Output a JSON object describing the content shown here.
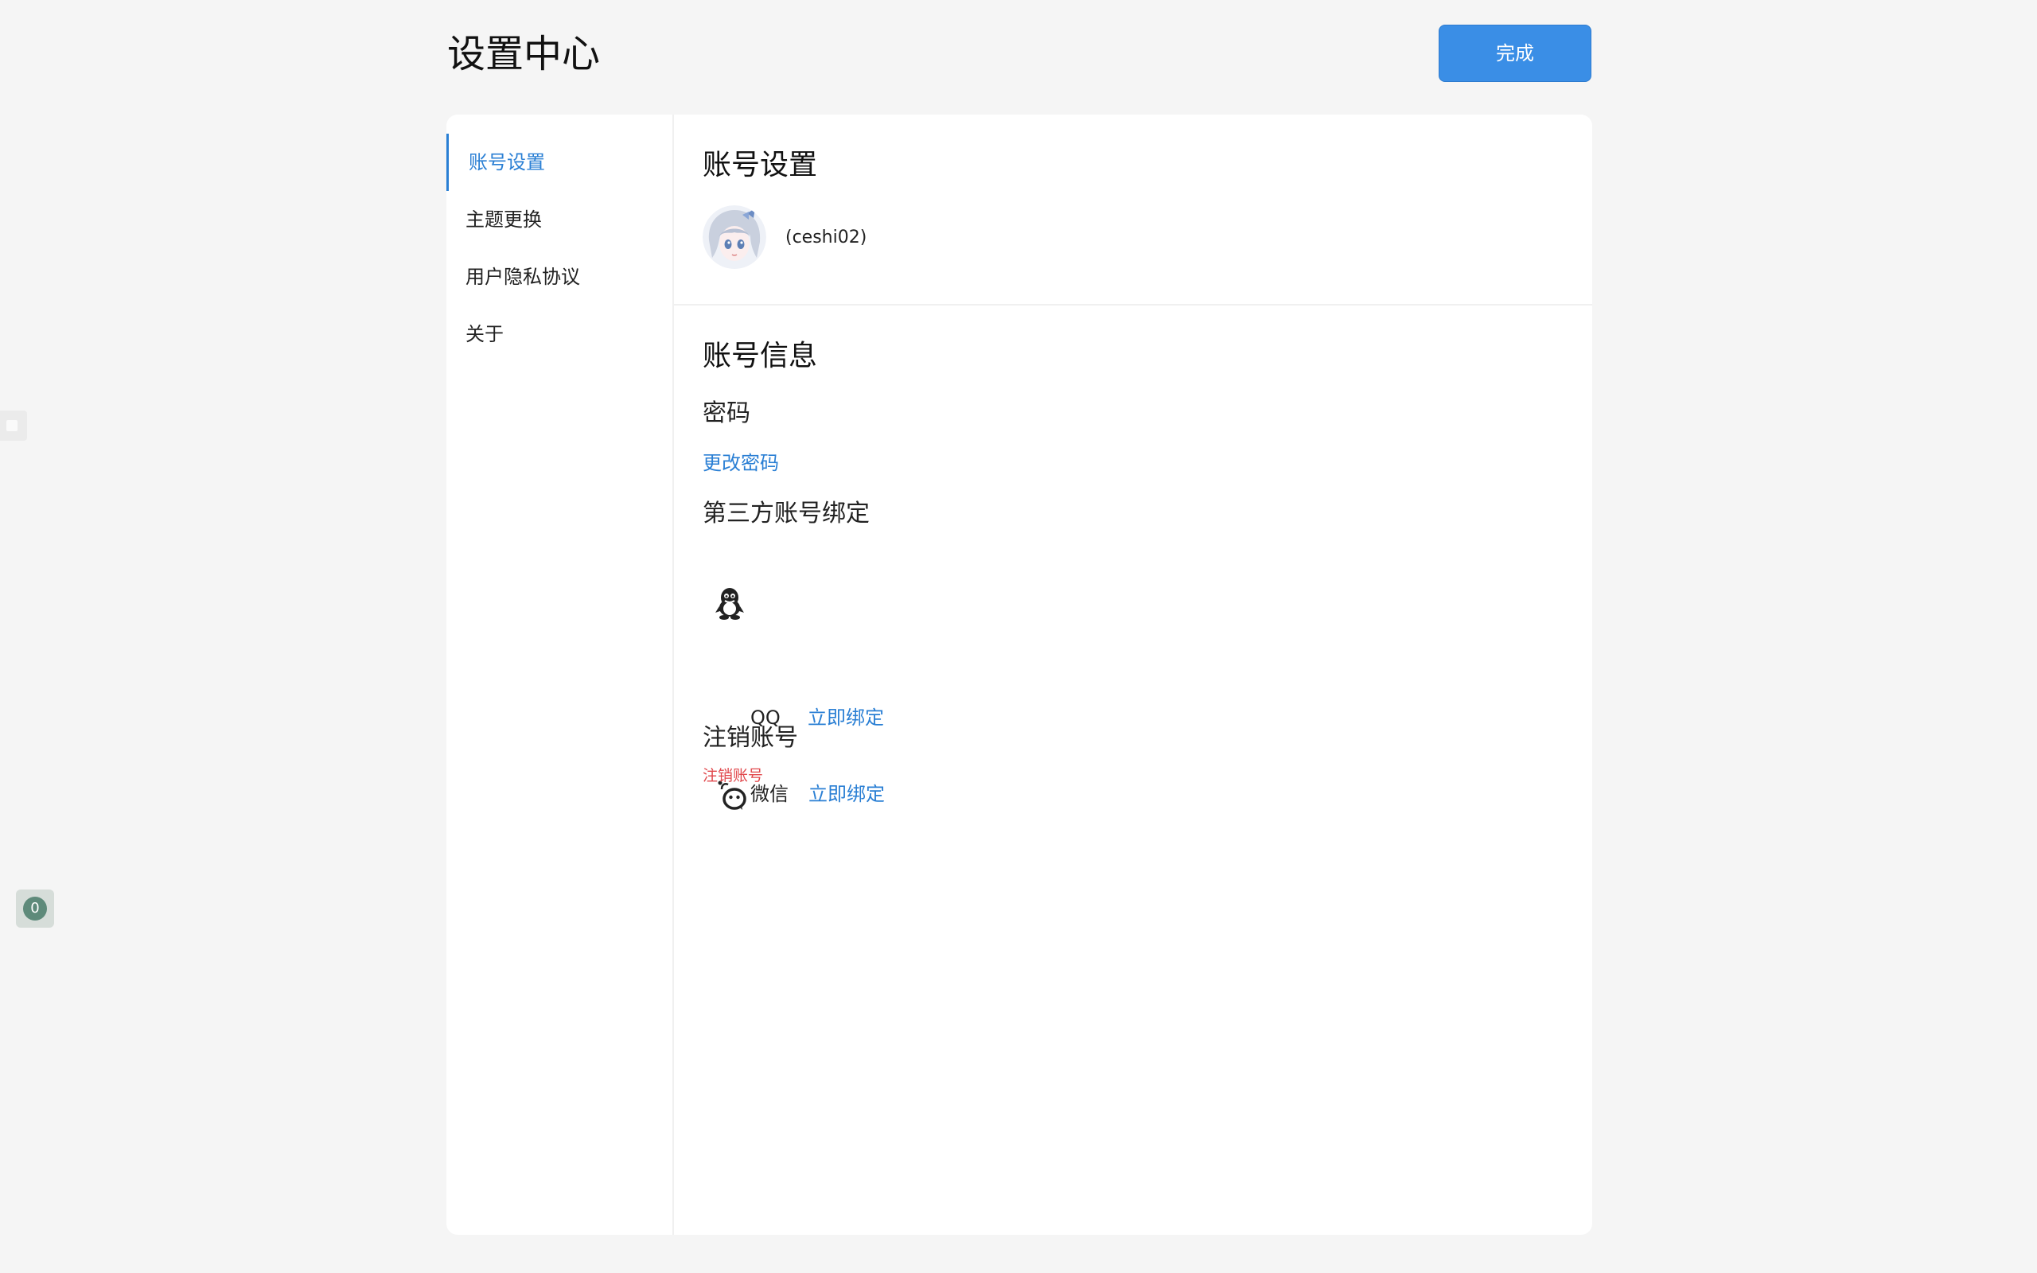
{
  "header": {
    "title": "设置中心",
    "done_label": "完成"
  },
  "sidebar": {
    "items": [
      {
        "label": "账号设置",
        "active": true
      },
      {
        "label": "主题更换",
        "active": false
      },
      {
        "label": "用户隐私协议",
        "active": false
      },
      {
        "label": "关于",
        "active": false
      }
    ]
  },
  "account_settings": {
    "heading": "账号设置",
    "username": "(ceshi02)"
  },
  "account_info": {
    "heading": "账号信息",
    "password_heading": "密码",
    "change_password_label": "更改密码",
    "third_party_heading": "第三方账号绑定",
    "bindings": [
      {
        "name": "QQ",
        "icon": "qq-icon",
        "action_label": "立即绑定"
      },
      {
        "name": "微信",
        "icon": "wechat-icon",
        "action_label": "立即绑定"
      }
    ],
    "deactivate_heading": "注销账号",
    "deactivate_label": "注销账号"
  },
  "floating": {
    "badge_count": "0"
  },
  "colors": {
    "accent": "#2a7fd4",
    "primary_button": "#3a8ee6",
    "danger": "#e0474b",
    "background": "#f5f5f5"
  }
}
